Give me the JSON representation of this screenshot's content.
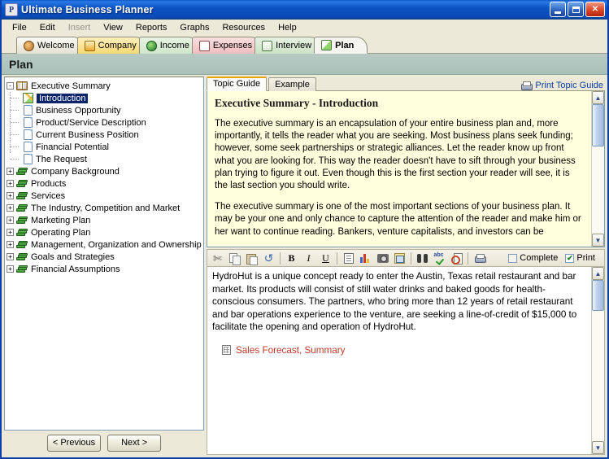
{
  "window": {
    "title": "Ultimate Business Planner",
    "icon": "app-icon",
    "minimize_label": "Minimize",
    "restore_label": "Restore",
    "close_label": "Close"
  },
  "menubar": {
    "items": [
      {
        "label": "File",
        "disabled": false
      },
      {
        "label": "Edit",
        "disabled": false
      },
      {
        "label": "Insert",
        "disabled": true
      },
      {
        "label": "View",
        "disabled": false
      },
      {
        "label": "Reports",
        "disabled": false
      },
      {
        "label": "Graphs",
        "disabled": false
      },
      {
        "label": "Resources",
        "disabled": false
      },
      {
        "label": "Help",
        "disabled": false
      }
    ]
  },
  "tabs": [
    {
      "label": "Welcome",
      "icon": "welcome-icon",
      "active": false
    },
    {
      "label": "Company",
      "icon": "house-icon",
      "active": false
    },
    {
      "label": "Income",
      "icon": "globe-icon",
      "active": false
    },
    {
      "label": "Expenses",
      "icon": "form-icon",
      "active": false
    },
    {
      "label": "Interview",
      "icon": "clipboard-icon",
      "active": false
    },
    {
      "label": "Plan",
      "icon": "pencil-icon",
      "active": true
    }
  ],
  "page": {
    "title": "Plan"
  },
  "tree": {
    "nodes": [
      {
        "label": "Executive Summary",
        "icon": "open-book-icon",
        "expander": "-",
        "level": 0,
        "selected": false
      },
      {
        "label": "Introduction",
        "icon": "doc-pencil-icon",
        "expander": "",
        "level": 1,
        "selected": true
      },
      {
        "label": "Business Opportunity",
        "icon": "document-icon",
        "expander": "",
        "level": 1,
        "selected": false
      },
      {
        "label": "Product/Service Description",
        "icon": "document-icon",
        "expander": "",
        "level": 1,
        "selected": false
      },
      {
        "label": "Current Business Position",
        "icon": "document-icon",
        "expander": "",
        "level": 1,
        "selected": false
      },
      {
        "label": "Financial Potential",
        "icon": "document-icon",
        "expander": "",
        "level": 1,
        "selected": false
      },
      {
        "label": "The Request",
        "icon": "document-icon",
        "expander": "",
        "level": 1,
        "selected": false
      },
      {
        "label": "Company Background",
        "icon": "green-books-icon",
        "expander": "+",
        "level": 0,
        "selected": false
      },
      {
        "label": "Products",
        "icon": "green-books-icon",
        "expander": "+",
        "level": 0,
        "selected": false
      },
      {
        "label": "Services",
        "icon": "green-books-icon",
        "expander": "+",
        "level": 0,
        "selected": false
      },
      {
        "label": "The Industry, Competition and Market",
        "icon": "green-books-icon",
        "expander": "+",
        "level": 0,
        "selected": false
      },
      {
        "label": "Marketing Plan",
        "icon": "green-books-icon",
        "expander": "+",
        "level": 0,
        "selected": false
      },
      {
        "label": "Operating Plan",
        "icon": "green-books-icon",
        "expander": "+",
        "level": 0,
        "selected": false
      },
      {
        "label": "Management, Organization and Ownership",
        "icon": "green-books-icon",
        "expander": "+",
        "level": 0,
        "selected": false
      },
      {
        "label": "Goals and Strategies",
        "icon": "green-books-icon",
        "expander": "+",
        "level": 0,
        "selected": false
      },
      {
        "label": "Financial Assumptions",
        "icon": "green-books-icon",
        "expander": "+",
        "level": 0,
        "selected": false
      }
    ],
    "previous_button": "< Previous",
    "next_button": "Next >"
  },
  "guide": {
    "tabs": [
      {
        "label": "Topic Guide",
        "active": true
      },
      {
        "label": "Example",
        "active": false
      }
    ],
    "print_link": "Print Topic Guide",
    "print_icon": "printer-icon",
    "heading": "Executive Summary - Introduction",
    "paragraphs": [
      "The executive summary is an encapsulation of your entire business plan and, more importantly, it tells the reader what you are seeking. Most business plans seek funding; however, some seek partnerships or strategic alliances. Let the reader know up front what you are looking for. This way the reader doesn't have to sift through your business plan trying to figure it out. Even though this is the first section your reader will see, it is the last section you should write.",
      "The executive summary is one of the most important sections of your business plan. It may be your one and only chance to capture the attention of the reader and make him or her want to continue reading. Bankers, venture capitalists, and investors can be"
    ]
  },
  "toolbar": {
    "buttons": [
      {
        "name": "cut",
        "icon": "scissors-icon",
        "label": "Cut"
      },
      {
        "name": "copy",
        "icon": "copy-icon",
        "label": "Copy"
      },
      {
        "name": "paste",
        "icon": "paste-icon",
        "label": "Paste"
      },
      {
        "name": "undo",
        "icon": "undo-icon",
        "label": "Undo"
      },
      {
        "name": "bold",
        "icon": "bold-icon",
        "label": "B"
      },
      {
        "name": "italic",
        "icon": "italic-icon",
        "label": "I"
      },
      {
        "name": "underline",
        "icon": "underline-icon",
        "label": "U"
      },
      {
        "name": "insert-page",
        "icon": "page-icon",
        "label": "Insert Page"
      },
      {
        "name": "insert-chart",
        "icon": "bar-chart-icon",
        "label": "Insert Chart"
      },
      {
        "name": "insert-image",
        "icon": "camera-icon",
        "label": "Insert Image"
      },
      {
        "name": "insert-object",
        "icon": "insert-object-icon",
        "label": "Insert Object"
      },
      {
        "name": "find",
        "icon": "binoculars-icon",
        "label": "Find"
      },
      {
        "name": "spell-check",
        "icon": "spellcheck-icon",
        "label": "Spell Check"
      },
      {
        "name": "print-preview",
        "icon": "print-preview-icon",
        "label": "Print Preview"
      },
      {
        "name": "print",
        "icon": "printer-icon",
        "label": "Print"
      }
    ],
    "complete_label": "Complete",
    "complete_checked": false,
    "print_label": "Print",
    "print_checked": true
  },
  "editor": {
    "paragraph": "HydroHut is a unique concept ready to enter the Austin, Texas retail restaurant and bar market. Its products will consist of still water drinks and baked goods for health-conscious consumers. The partners, who bring more than 12 years of retail restaurant and bar operations experience to the venture, are seeking a line-of-credit of $15,000 to facilitate the opening and operation of HydroHut.",
    "link": "Sales Forecast, Summary",
    "link_icon": "spreadsheet-icon"
  },
  "colors": {
    "titlebar_blue": "#0b53c4",
    "tab_company_yellow": "#f6d873",
    "tab_expenses_pink": "#f2bdc0",
    "guide_background": "#ffffdd",
    "page_header": "#a9c0b8",
    "link_red": "#c0392b",
    "link_blue": "#0b3fa0",
    "selection_blue": "#0a246a"
  }
}
